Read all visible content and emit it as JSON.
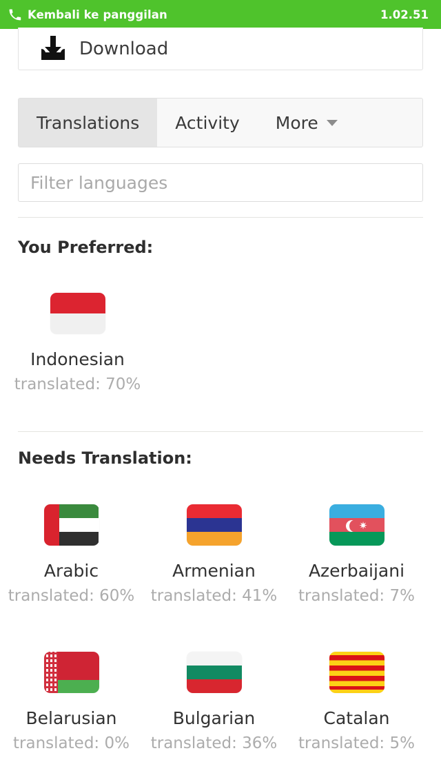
{
  "callbar": {
    "icon": "phone-icon",
    "label": "Kembali ke panggilan",
    "timer": "1.02.51",
    "background": "#4fc32c",
    "text_color": "#ffffff"
  },
  "download_card": {
    "icon": "download-icon",
    "label": "Download"
  },
  "tabs": [
    {
      "label": "Translations",
      "active": true
    },
    {
      "label": "Activity",
      "active": false
    },
    {
      "label": "More",
      "active": false,
      "icon": "chevron-down-icon"
    }
  ],
  "filter": {
    "placeholder": "Filter languages",
    "value": ""
  },
  "sections": [
    {
      "title": "You Preferred:",
      "languages": [
        {
          "name": "Indonesian",
          "progress": "translated: 70%",
          "flag": "indonesia"
        }
      ]
    },
    {
      "title": "Needs Translation:",
      "languages": [
        {
          "name": "Arabic",
          "progress": "translated: 60%",
          "flag": "united-arab-emirates"
        },
        {
          "name": "Armenian",
          "progress": "translated: 41%",
          "flag": "armenia"
        },
        {
          "name": "Azerbaijani",
          "progress": "translated: 7%",
          "flag": "azerbaijan"
        },
        {
          "name": "Belarusian",
          "progress": "translated: 0%",
          "flag": "belarus"
        },
        {
          "name": "Bulgarian",
          "progress": "translated: 36%",
          "flag": "bulgaria"
        },
        {
          "name": "Catalan",
          "progress": "translated: 5%",
          "flag": "catalonia"
        }
      ]
    }
  ]
}
